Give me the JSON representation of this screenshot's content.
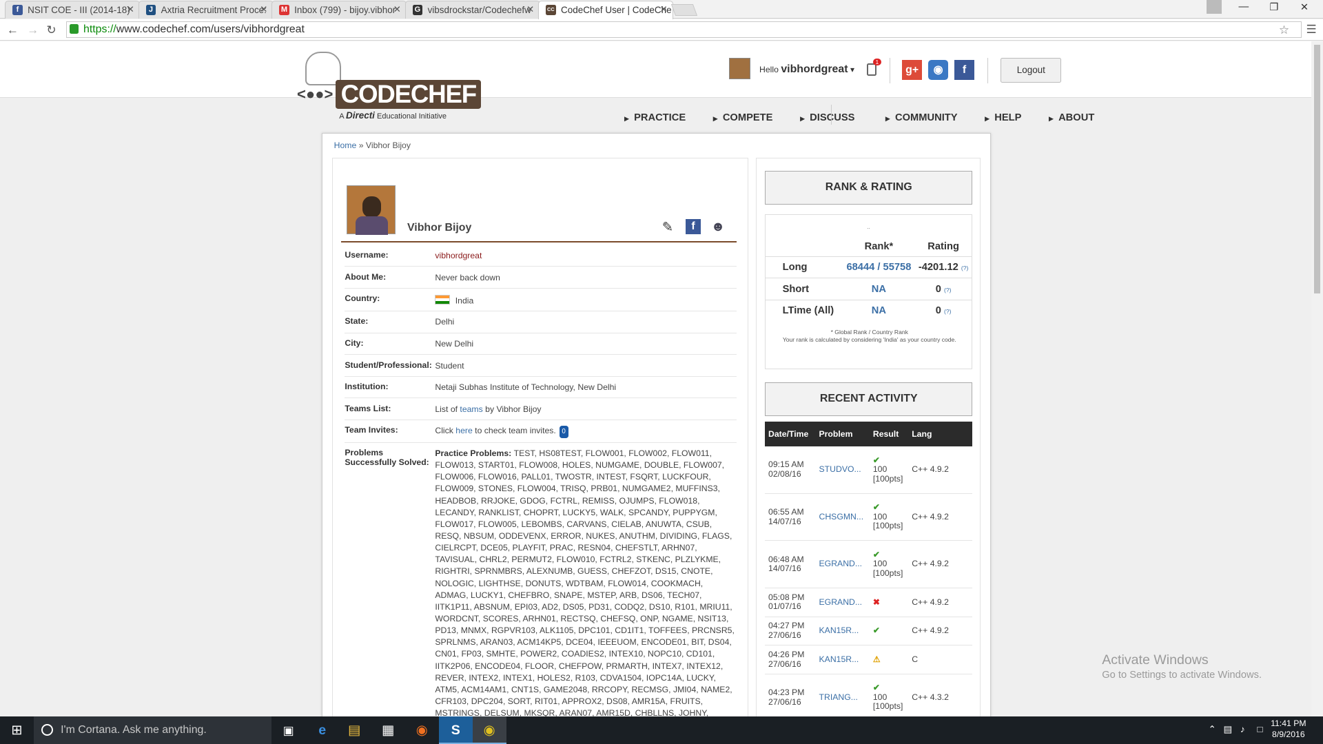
{
  "browser": {
    "tabs": [
      {
        "label": "NSIT COE - III (2014-18)",
        "icon": "facebook-icon",
        "color": "#3b5998",
        "glyph": "f"
      },
      {
        "label": "Axtria Recruitment Proce:",
        "icon": "jira-icon",
        "color": "#205081",
        "glyph": "J"
      },
      {
        "label": "Inbox (799) - bijoy.vibhor",
        "icon": "gmail-icon",
        "color": "#d33",
        "glyph": "M"
      },
      {
        "label": "vibsdrockstar/Codechefw",
        "icon": "github-icon",
        "color": "#333",
        "glyph": "G"
      },
      {
        "label": "CodeChef User | CodeChe",
        "icon": "codechef-icon",
        "color": "#5b4636",
        "glyph": "CC"
      }
    ],
    "url_scheme": "https://",
    "url_rest": "www.codechef.com/users/vibhordgreat"
  },
  "header": {
    "logo_word": "CODECHEF",
    "logo_face": "<●●>",
    "logo_tag_a": "A ",
    "logo_tag_b": "Directi",
    "logo_tag_c": " Educational Initiative",
    "hello": "Hello ",
    "username": "vibhordgreat",
    "notification_count": "1",
    "logout": "Logout",
    "nav": {
      "practice": "PRACTICE",
      "compete": "COMPETE",
      "discuss": "DISCUSS",
      "community": "COMMUNITY",
      "help": "HELP",
      "about": "ABOUT"
    }
  },
  "breadcrumb": {
    "home": "Home",
    "sep": " » ",
    "current": "Vibhor Bijoy"
  },
  "profile": {
    "name": "Vibhor Bijoy",
    "rows": {
      "username_label": "Username:",
      "username": "vibhordgreat",
      "about_label": "About Me:",
      "about": "Never back down",
      "country_label": "Country:",
      "country": "India",
      "state_label": "State:",
      "state": "Delhi",
      "city_label": "City:",
      "city": "New Delhi",
      "role_label": "Student/Professional:",
      "role": "Student",
      "institution_label": "Institution:",
      "institution": "Netaji Subhas Institute of Technology, New Delhi",
      "teams_label": "Teams List:",
      "teams_pre": "List of ",
      "teams_link": "teams",
      "teams_post": " by Vibhor Bijoy",
      "invites_label": "Team Invites:",
      "invites_pre": "Click ",
      "invites_link": "here",
      "invites_post": " to check team invites.",
      "invites_count": "0",
      "problems_label": "Problems Successfully Solved:",
      "problems_heading": "Practice Problems",
      "problems": "TEST, HS08TEST, FLOW001, FLOW002, FLOW011, FLOW013, START01, FLOW008, HOLES, NUMGAME, DOUBLE, FLOW007, FLOW006, FLOW016, PALL01, TWOSTR, INTEST, FSQRT, LUCKFOUR, FLOW009, STONES, FLOW004, TRISQ, PRB01, NUMGAME2, MUFFINS3, HEADBOB, RRJOKE, GDOG, FCTRL, REMISS, OJUMPS, FLOW018, LECANDY, RANKLIST, CHOPRT, LUCKY5, WALK, SPCANDY, PUPPYGM, FLOW017, FLOW005, LEBOMBS, CARVANS, CIELAB, ANUWTA, CSUB, RESQ, NBSUM, ODDEVENX, ERROR, NUKES, ANUTHM, DIVIDING, FLAGS, CIELRCPT, DCE05, PLAYFIT, PRAC, RESN04, CHEFSTLT, ARHN07, TAVISUAL, CHRL2, PERMUT2, FLOW010, FCTRL2, STKENC, PLZLYKME, RIGHTRI, SPRNMBRS, ALEXNUMB, GUESS, CHEFZOT, DS15, CNOTE, NOLOGIC, LIGHTHSE, DONUTS, WDTBAM, FLOW014, COOKMACH, ADMAG, LUCKY1, CHEFBRO, SNAPE, MSTEP, ARB, DS06, TECH07, IITK1P11, ABSNUM, EPI03, AD2, DS05, PD31, CODQ2, DS10, R101, MRIU11, WORDCNT, SCORES, ARHN01, RECTSQ, CHEFSQ, ONP, NGAME, NSIT13, PD13, MNMX, RGPVR103, ALK1105, DPC101, CD1IT1, TOFFEES, PRCNSR5, SPRLNMS, ARAN03, ACM14KP5, DCE04, IEEEUOM, ENCODE01, BIT, DS04, CN01, FP03, SMHTE, POWER2, COADIES2, INTEX10, NOPC10, CD101, IITK2P06, ENCODE04, FLOOR, CHEFPOW, PRMARTH, INTEX7, INTEX12, REVER, INTEX2, INTEX1, HOLES2, R103, CDVA1504, IOPC14A, LUCKY, ATM5, ACM14AM1, CNT1S, GAME2048, RRCOPY, RECMSG, JMI04, NAME2, CFR103, DPC204, SORT, RIT01, APPROX2, DS08, AMR15A, FRUITS, MSTRINGS, DELSUM, MKSQR, ARAN07, AMR15D, CHBLLNS, JOHNY, TRICOIN, ACBALL, MOVIEWKN, KTTABLE, TAAPLUSB, INTEG, RRCODE,"
    }
  },
  "rank": {
    "title": "RANK & RATING",
    "dots": "..",
    "col_rank": "Rank*",
    "col_rating": "Rating",
    "rows": [
      {
        "name": "Long",
        "rank": "68444 / 55758",
        "rating": "-4201.12",
        "q": "(?)"
      },
      {
        "name": "Short",
        "rank": "NA",
        "rating": "0",
        "q": "(?)"
      },
      {
        "name": "LTime (All)",
        "rank": "NA",
        "rating": "0",
        "q": "(?)"
      }
    ],
    "note1": "* Global Rank / Country Rank",
    "note2": "Your rank is calculated by considering 'India' as your country code."
  },
  "activity": {
    "title": "RECENT ACTIVITY",
    "cols": [
      "Date/Time",
      "Problem",
      "Result",
      "Lang"
    ],
    "rows": [
      {
        "time": "09:15 AM",
        "date": "02/08/16",
        "problem": "STUDVO...",
        "status": "ok",
        "result": "100 [100pts]",
        "lang": "C++ 4.9.2"
      },
      {
        "time": "06:55 AM",
        "date": "14/07/16",
        "problem": "CHSGMN...",
        "status": "ok",
        "result": "100 [100pts]",
        "lang": "C++ 4.9.2"
      },
      {
        "time": "06:48 AM",
        "date": "14/07/16",
        "problem": "EGRAND...",
        "status": "ok",
        "result": "100 [100pts]",
        "lang": "C++ 4.9.2"
      },
      {
        "time": "05:08 PM",
        "date": "01/07/16",
        "problem": "EGRAND...",
        "status": "wrong",
        "result": "",
        "lang": "C++ 4.9.2"
      },
      {
        "time": "04:27 PM",
        "date": "27/06/16",
        "problem": "KAN15R...",
        "status": "ok",
        "result": "",
        "lang": "C++ 4.9.2"
      },
      {
        "time": "04:26 PM",
        "date": "27/06/16",
        "problem": "KAN15R...",
        "status": "warn",
        "result": "",
        "lang": "C"
      },
      {
        "time": "04:23 PM",
        "date": "27/06/16",
        "problem": "TRIANG...",
        "status": "ok",
        "result": "100 [100pts]",
        "lang": "C++ 4.3.2"
      }
    ]
  },
  "watermark": {
    "line1": "Activate Windows",
    "line2": "Go to Settings to activate Windows."
  },
  "taskbar": {
    "cortana": "I'm Cortana. Ask me anything.",
    "time": "11:41 PM",
    "date": "8/9/2016"
  }
}
